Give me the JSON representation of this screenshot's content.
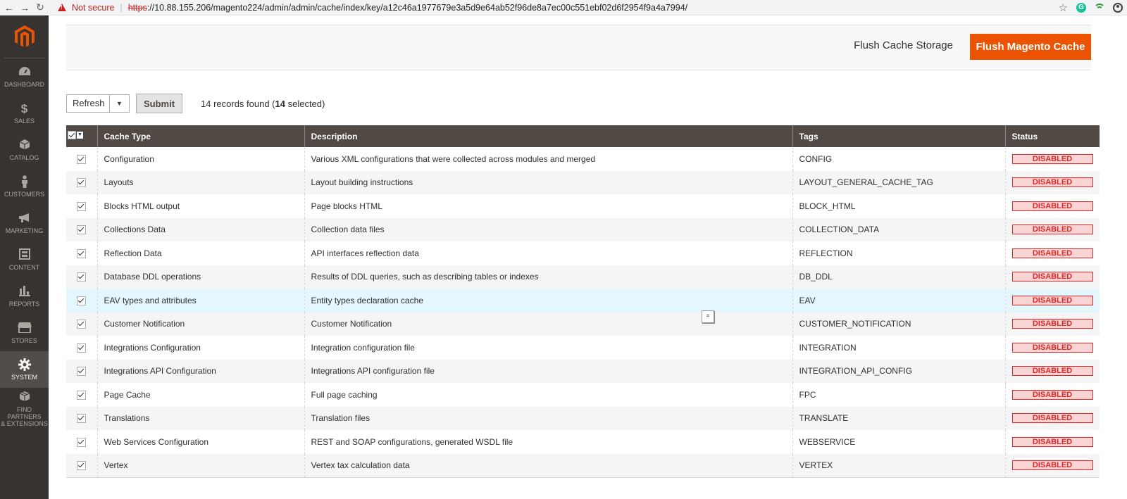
{
  "browser": {
    "security_label": "Not secure",
    "url_scheme": "https",
    "url_rest": "://10.88.155.206/magento224/admin/admin/cache/index/key/a12c46a1977679e3a5d9e64ab52f96de8a7ec00c551ebf02d6f2954f9a4a7994/"
  },
  "sidebar": {
    "items": [
      {
        "label": "DASHBOARD",
        "icon": "dashboard-icon"
      },
      {
        "label": "SALES",
        "icon": "dollar-icon"
      },
      {
        "label": "CATALOG",
        "icon": "box-icon"
      },
      {
        "label": "CUSTOMERS",
        "icon": "person-icon"
      },
      {
        "label": "MARKETING",
        "icon": "megaphone-icon"
      },
      {
        "label": "CONTENT",
        "icon": "layout-icon"
      },
      {
        "label": "REPORTS",
        "icon": "bar-chart-icon"
      },
      {
        "label": "STORES",
        "icon": "storefront-icon"
      },
      {
        "label": "SYSTEM",
        "icon": "gear-icon"
      },
      {
        "label1": "FIND PARTNERS",
        "label2": "& EXTENSIONS",
        "icon": "package-icon"
      }
    ]
  },
  "actions": {
    "flush_storage": "Flush Cache Storage",
    "flush_magento": "Flush Magento Cache"
  },
  "toolbar": {
    "action_value": "Refresh",
    "submit": "Submit",
    "records_pre": "14 records found (",
    "records_selected": "14",
    "records_post": " selected)"
  },
  "table": {
    "headers": {
      "cache_type": "Cache Type",
      "description": "Description",
      "tags": "Tags",
      "status": "Status"
    },
    "rows": [
      {
        "type": "Configuration",
        "desc": "Various XML configurations that were collected across modules and merged",
        "tags": "CONFIG",
        "status": "DISABLED"
      },
      {
        "type": "Layouts",
        "desc": "Layout building instructions",
        "tags": "LAYOUT_GENERAL_CACHE_TAG",
        "status": "DISABLED"
      },
      {
        "type": "Blocks HTML output",
        "desc": "Page blocks HTML",
        "tags": "BLOCK_HTML",
        "status": "DISABLED"
      },
      {
        "type": "Collections Data",
        "desc": "Collection data files",
        "tags": "COLLECTION_DATA",
        "status": "DISABLED"
      },
      {
        "type": "Reflection Data",
        "desc": "API interfaces reflection data",
        "tags": "REFLECTION",
        "status": "DISABLED"
      },
      {
        "type": "Database DDL operations",
        "desc": "Results of DDL queries, such as describing tables or indexes",
        "tags": "DB_DDL",
        "status": "DISABLED"
      },
      {
        "type": "EAV types and attributes",
        "desc": "Entity types declaration cache",
        "tags": "EAV",
        "status": "DISABLED"
      },
      {
        "type": "Customer Notification",
        "desc": "Customer Notification",
        "tags": "CUSTOMER_NOTIFICATION",
        "status": "DISABLED"
      },
      {
        "type": "Integrations Configuration",
        "desc": "Integration configuration file",
        "tags": "INTEGRATION",
        "status": "DISABLED"
      },
      {
        "type": "Integrations API Configuration",
        "desc": "Integrations API configuration file",
        "tags": "INTEGRATION_API_CONFIG",
        "status": "DISABLED"
      },
      {
        "type": "Page Cache",
        "desc": "Full page caching",
        "tags": "FPC",
        "status": "DISABLED"
      },
      {
        "type": "Translations",
        "desc": "Translation files",
        "tags": "TRANSLATE",
        "status": "DISABLED"
      },
      {
        "type": "Web Services Configuration",
        "desc": "REST and SOAP configurations, generated WSDL file",
        "tags": "WEBSERVICE",
        "status": "DISABLED"
      },
      {
        "type": "Vertex",
        "desc": "Vertex tax calculation data",
        "tags": "VERTEX",
        "status": "DISABLED"
      }
    ]
  },
  "colors": {
    "accent": "#eb5202",
    "sidebar_bg": "#373330",
    "header_bg": "#514943",
    "status_red": "#e22626"
  }
}
